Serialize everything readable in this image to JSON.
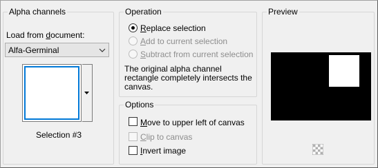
{
  "alpha_channels": {
    "title": "Alpha channels",
    "load_label_pre": "Load from ",
    "load_label_ul": "d",
    "load_label_post": "ocument:",
    "document_value": "Alfa-Germinal",
    "selection_label": "Selection #3"
  },
  "operation": {
    "title": "Operation",
    "options": [
      {
        "ul": "R",
        "rest": "eplace selection",
        "selected": true,
        "enabled": true
      },
      {
        "ul": "A",
        "rest": "dd to current selection",
        "selected": false,
        "enabled": false
      },
      {
        "ul": "S",
        "rest": "ubtract from current selection",
        "selected": false,
        "enabled": false
      }
    ],
    "description_lines": [
      "The original alpha channel",
      "rectangle completely intersects the",
      "canvas."
    ]
  },
  "options": {
    "title": "Options",
    "items": [
      {
        "ul": "M",
        "rest": "ove to upper left of canvas",
        "checked": false,
        "enabled": true
      },
      {
        "ul": "C",
        "rest": "lip to canvas",
        "checked": false,
        "enabled": false
      },
      {
        "ul": "I",
        "rest": "nvert image",
        "checked": false,
        "enabled": true
      }
    ]
  },
  "preview": {
    "title": "Preview",
    "toggle_icon": "checkerboard-icon"
  }
}
